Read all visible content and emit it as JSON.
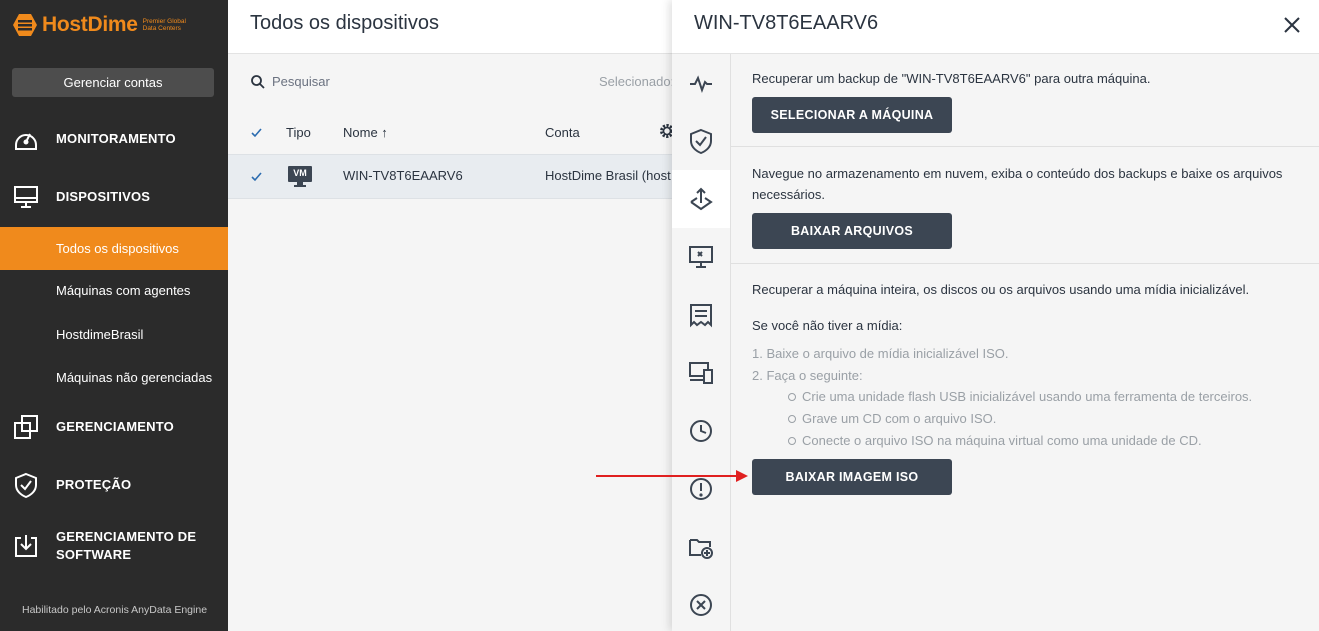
{
  "brand": {
    "name": "HostDime",
    "tagline_line1": "Premier Global",
    "tagline_line2": "Data Centers",
    "accent": "#f08a1c"
  },
  "sidebar": {
    "manage_accounts": "Gerenciar contas",
    "sections": [
      {
        "label": "MONITORAMENTO",
        "icon": "gauge-icon"
      },
      {
        "label": "DISPOSITIVOS",
        "icon": "monitor-icon"
      },
      {
        "label": "GERENCIAMENTO",
        "icon": "management-icon"
      },
      {
        "label": "PROTEÇÃO",
        "icon": "shield-icon"
      },
      {
        "label_line1": "GERENCIAMENTO DE",
        "label_line2": "SOFTWARE",
        "icon": "software-download-icon"
      }
    ],
    "device_items": [
      {
        "label": "Todos os dispositivos",
        "active": true
      },
      {
        "label": "Máquinas com agentes",
        "active": false
      },
      {
        "label": "HostdimeBrasil",
        "active": false
      },
      {
        "label": "Máquinas não gerenciadas",
        "active": false
      }
    ],
    "footer": "Habilitado pelo Acronis AnyData Engine"
  },
  "main": {
    "title": "Todos os dispositivos",
    "search_placeholder": "Pesquisar",
    "selected_label": "Selecionado:",
    "columns": {
      "type": "Tipo",
      "name": "Nome ↑",
      "account": "Conta"
    },
    "rows": [
      {
        "type_badge": "VM",
        "name": "WIN-TV8T6EAARV6",
        "account": "HostDime Brasil (host",
        "checked": true
      }
    ]
  },
  "panel": {
    "title": "WIN-TV8T6EAARV6",
    "rail_icons": [
      "activity-icon",
      "shield-check-icon",
      "recovery-icon",
      "remote-desktop-icon",
      "details-icon",
      "devices-icon",
      "history-icon",
      "alert-icon",
      "add-folder-icon",
      "delete-icon"
    ],
    "section1": {
      "text": "Recuperar um backup de \"WIN-TV8T6EAARV6\" para outra máquina.",
      "button": "SELECIONAR A MÁQUINA"
    },
    "section2": {
      "text_line1": "Navegue no armazenamento em nuvem, exiba o conteúdo dos backups e baixe os arquivos",
      "text_line2": "necessários.",
      "button": "BAIXAR ARQUIVOS"
    },
    "section3": {
      "text": "Recuperar a máquina inteira, os discos ou os arquivos usando uma mídia inicializável.",
      "no_media": "Se você não tiver a mídia:",
      "step1": "1. Baixe o arquivo de mídia inicializável ISO.",
      "step2": "2. Faça o seguinte:",
      "sub1": "Crie uma unidade flash USB inicializável usando uma ferramenta de terceiros.",
      "sub2": "Grave um CD com o arquivo ISO.",
      "sub3": "Conecte o arquivo ISO na máquina virtual como uma unidade de CD.",
      "button": "BAIXAR IMAGEM ISO"
    }
  },
  "colors": {
    "sidebar_bg": "#2b2b2b",
    "button_dark": "#3c4653",
    "arrow": "#e02020"
  }
}
